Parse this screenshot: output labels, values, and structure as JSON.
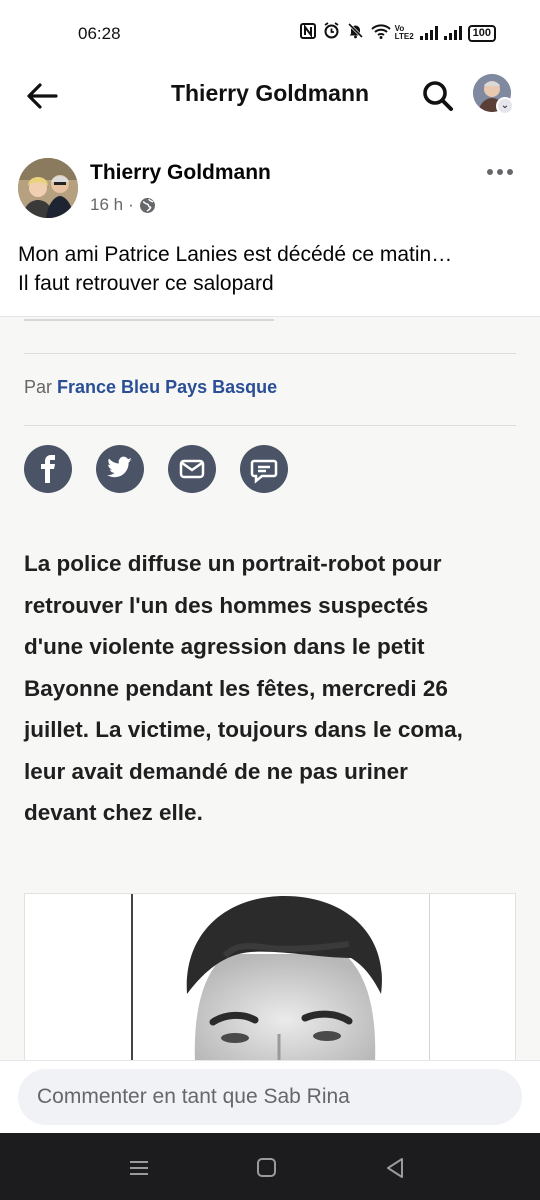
{
  "status_bar": {
    "time": "06:28",
    "icons": [
      "nfc-icon",
      "alarm-icon",
      "mute-icon",
      "wifi-icon",
      "volte-icon",
      "signal-icon",
      "signal-icon",
      "battery-icon"
    ],
    "volte_label": "Vo",
    "lte_label": "LTE",
    "lte_sub": "2",
    "battery_text": "100",
    "battery_level": 1.0,
    "battery_color": "#d9b929"
  },
  "header": {
    "title": "Thierry Goldmann",
    "back_icon": "arrow-left-icon",
    "search_icon": "search-icon",
    "avatar_icon": "profile-avatar"
  },
  "post": {
    "author": "Thierry Goldmann",
    "time": "16 h",
    "separator": "·",
    "audience_icon": "globe-icon",
    "text_line1": "Mon ami Patrice Lanies est décédé ce matin…",
    "text_line2": "Il faut retrouver ce salopard"
  },
  "article": {
    "byline_prefix": "Par",
    "byline_source": "France Bleu Pays Basque",
    "share_icons": [
      "facebook-icon",
      "twitter-icon",
      "email-icon",
      "comment-icon"
    ],
    "body_lines": [
      "La police diffuse un portrait-robot pour",
      "retrouver l'un des hommes suspectés",
      "d'une violente agression dans le petit",
      "Bayonne pendant les fêtes, mercredi 26",
      "juillet. La victime, toujours dans le coma,",
      "leur avait demandé de ne pas uriner",
      "devant chez elle."
    ]
  },
  "comment": {
    "placeholder": "Commenter en tant que Sab Rina"
  },
  "nav": {
    "icons": [
      "recent-apps-icon",
      "home-icon",
      "back-icon"
    ]
  },
  "colors": {
    "text_primary": "#050505",
    "text_secondary": "#65676b",
    "link_blue": "#2a4f96",
    "share_button_bg": "#4a5466",
    "comment_input_bg": "#f0f2f5",
    "navbar_bg": "#1c1c1e"
  }
}
